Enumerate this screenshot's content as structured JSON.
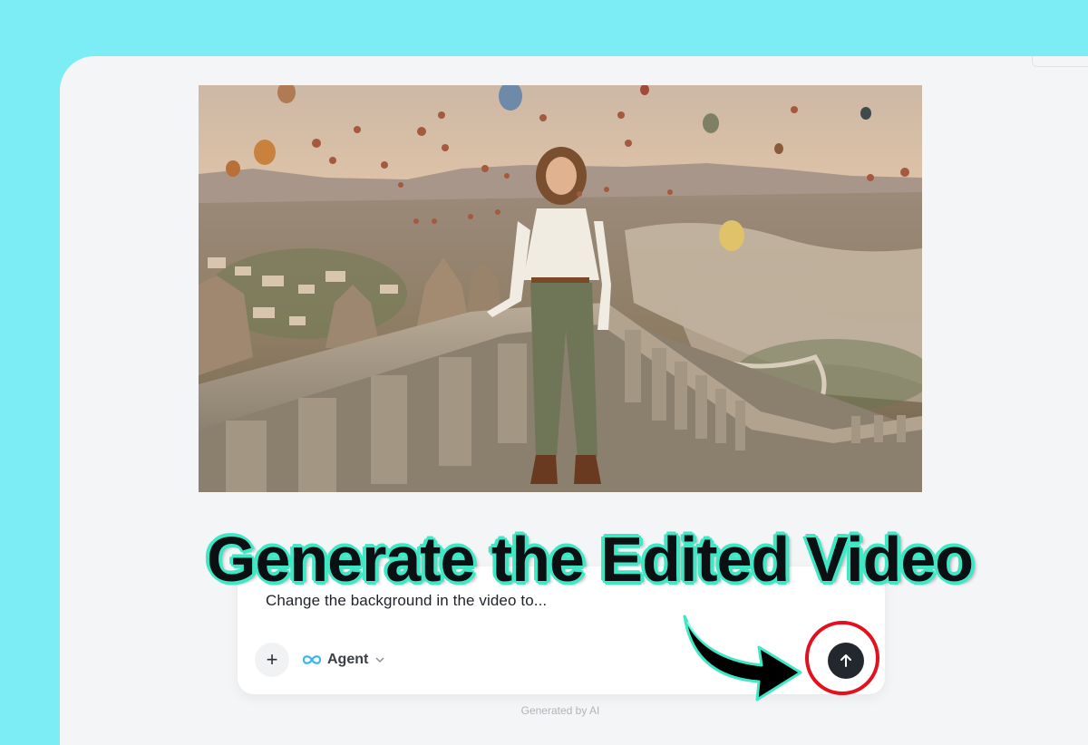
{
  "headline": "Generate the Edited Video",
  "prompt": {
    "placeholder": "Change the background in the video to...",
    "plus_label": "+",
    "agent_label": "Agent",
    "agent_icon": "infinity-icon",
    "send_icon": "arrow-up-icon"
  },
  "footer": "Generated by AI",
  "colors": {
    "page_background": "#7dedf5",
    "headline_outline": "#3fe8c5",
    "highlight_ring": "#e3101d",
    "send_button": "#23272e",
    "agent_icon": "#3ab7e6"
  }
}
